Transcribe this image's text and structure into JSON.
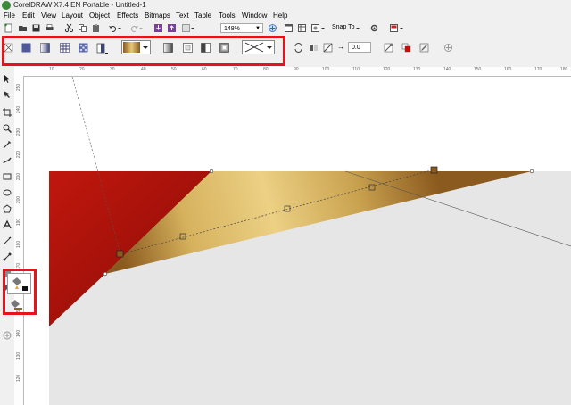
{
  "window": {
    "title": "CorelDRAW X7.4 EN Portable - Untitled-1"
  },
  "menu": [
    "File",
    "Edit",
    "View",
    "Layout",
    "Object",
    "Effects",
    "Bitmaps",
    "Text",
    "Table",
    "Tools",
    "Window",
    "Help"
  ],
  "standard_toolbar": {
    "zoom": "148%",
    "snap_to": "Snap To"
  },
  "property_bar": {
    "angle_value": "0.0"
  },
  "ruler": {
    "h_ticks": [
      "10",
      "20",
      "30",
      "40",
      "50",
      "60",
      "70",
      "80",
      "90",
      "100",
      "110",
      "120",
      "130",
      "140",
      "150",
      "160",
      "170",
      "180"
    ],
    "v_ticks": [
      "250",
      "240",
      "230",
      "220",
      "210",
      "200",
      "190",
      "180",
      "170",
      "160",
      "150",
      "140",
      "130",
      "120"
    ]
  },
  "colors": {
    "red": "#c0170e",
    "gold_light": "#ecd084",
    "gold_dark": "#8b5a1e",
    "highlight": "#e8121a",
    "page_gray": "#e6e6e6"
  }
}
